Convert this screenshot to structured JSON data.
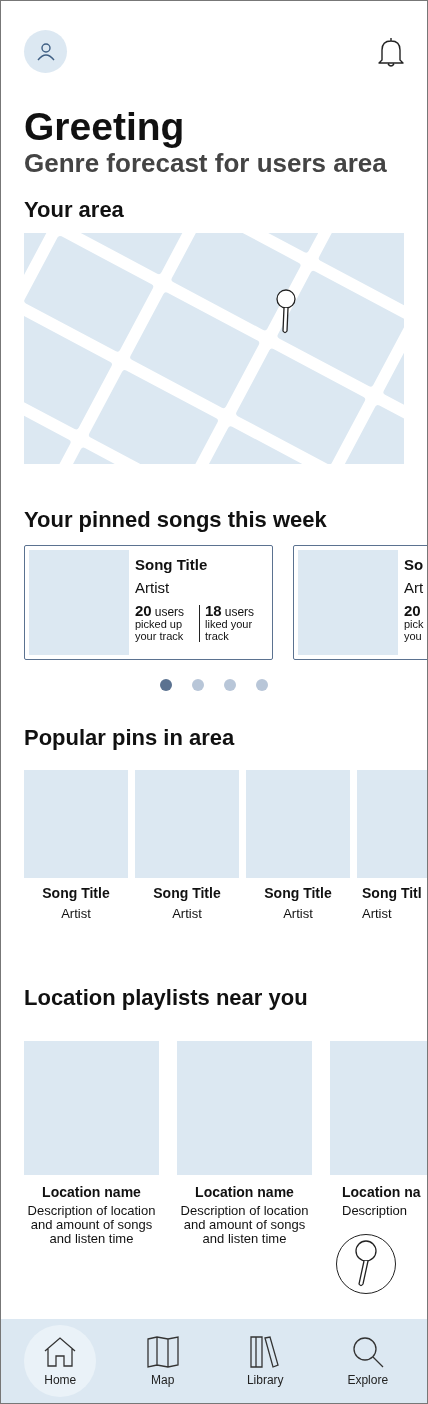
{
  "header": {
    "title": "Greeting",
    "subtitle": "Genre forecast for users area"
  },
  "area": {
    "title": "Your area"
  },
  "pinned": {
    "title": "Your pinned songs this week",
    "cards": [
      {
        "title": "Song Title",
        "artist": "Artist",
        "picked_count": "20",
        "picked_unit": "users",
        "picked_text": "picked up your track",
        "liked_count": "18",
        "liked_unit": "users",
        "liked_text": "liked your track"
      },
      {
        "title": "So",
        "artist": "Art",
        "picked_count": "20",
        "picked_text": "pick\nyou"
      }
    ],
    "dots": [
      {
        "selected": true
      },
      {
        "selected": false
      },
      {
        "selected": false
      },
      {
        "selected": false
      }
    ]
  },
  "popular": {
    "title": "Popular pins in area",
    "items": [
      {
        "title": "Song Title",
        "artist": "Artist"
      },
      {
        "title": "Song Title",
        "artist": "Artist"
      },
      {
        "title": "Song Title",
        "artist": "Artist"
      },
      {
        "title": "Song Titl",
        "artist": "Artist"
      }
    ]
  },
  "playlists": {
    "title": "Location playlists near you",
    "items": [
      {
        "name": "Location name",
        "description": "Description of location and amount of songs and listen time"
      },
      {
        "name": "Location name",
        "description": "Description of location and amount of songs and listen time"
      },
      {
        "name": "Location na",
        "description": "Description"
      }
    ]
  },
  "nav": [
    {
      "label": "Home",
      "kind": "home",
      "selected": true
    },
    {
      "label": "Map",
      "kind": "map",
      "selected": false
    },
    {
      "label": "Library",
      "kind": "library",
      "selected": false
    },
    {
      "label": "Explore",
      "kind": "explore",
      "selected": false
    }
  ]
}
